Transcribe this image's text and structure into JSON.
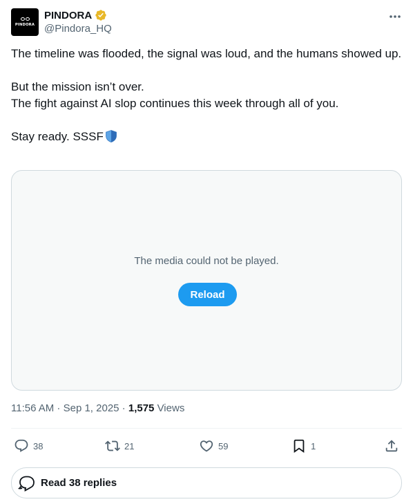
{
  "author": {
    "display_name": "PINDORA",
    "handle": "@Pindora_HQ",
    "avatar_text": "PINDORA",
    "verified_color": "#e8b829"
  },
  "tweet": {
    "line1": "The timeline was flooded, the signal was loud, and the humans showed up.",
    "line2": "But the mission isn’t over.",
    "line3": "The fight against AI slop continues this week through all of you.",
    "line4": "Stay ready. SSSF"
  },
  "media": {
    "error_text": "The media could not be played.",
    "reload_label": "Reload"
  },
  "meta": {
    "time": "11:56 AM",
    "date": "Sep 1, 2025",
    "views_count": "1,575",
    "views_label": "Views"
  },
  "actions": {
    "replies": "38",
    "reposts": "21",
    "likes": "59",
    "bookmarks": "1"
  },
  "read_replies_label": "Read 38 replies",
  "colors": {
    "accent": "#1d9bf0",
    "text_primary": "#0f1419",
    "text_secondary": "#536471",
    "border": "#cfd9de"
  }
}
